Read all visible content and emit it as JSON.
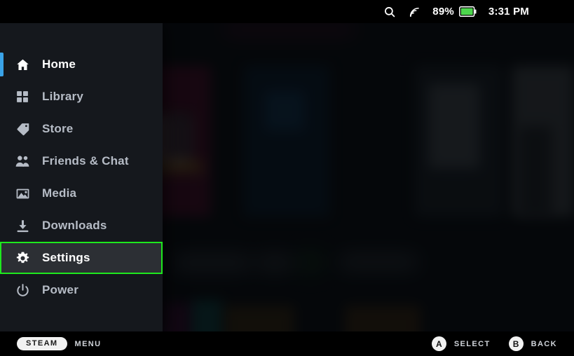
{
  "statusbar": {
    "search_icon": "search-icon",
    "wifi_icon": "wifi-signal-icon",
    "battery_percent": "89%",
    "battery_icon": "battery-icon",
    "battery_color": "#4cd64c",
    "time": "3:31 PM"
  },
  "sidebar": {
    "accent_color": "#3aa3e8",
    "focus_color": "#1ee81e",
    "items": [
      {
        "label": "Home",
        "icon": "home-icon",
        "state": "active"
      },
      {
        "label": "Library",
        "icon": "library-icon",
        "state": "normal"
      },
      {
        "label": "Store",
        "icon": "store-tag-icon",
        "state": "normal"
      },
      {
        "label": "Friends & Chat",
        "icon": "friends-icon",
        "state": "normal"
      },
      {
        "label": "Media",
        "icon": "media-icon",
        "state": "normal"
      },
      {
        "label": "Downloads",
        "icon": "download-icon",
        "state": "normal"
      },
      {
        "label": "Settings",
        "icon": "gear-icon",
        "state": "focused"
      },
      {
        "label": "Power",
        "icon": "power-icon",
        "state": "normal"
      }
    ]
  },
  "bottombar": {
    "steam_pill": "STEAM",
    "menu_label": "MENU",
    "select_button": "A",
    "select_label": "SELECT",
    "back_button": "B",
    "back_label": "BACK"
  }
}
